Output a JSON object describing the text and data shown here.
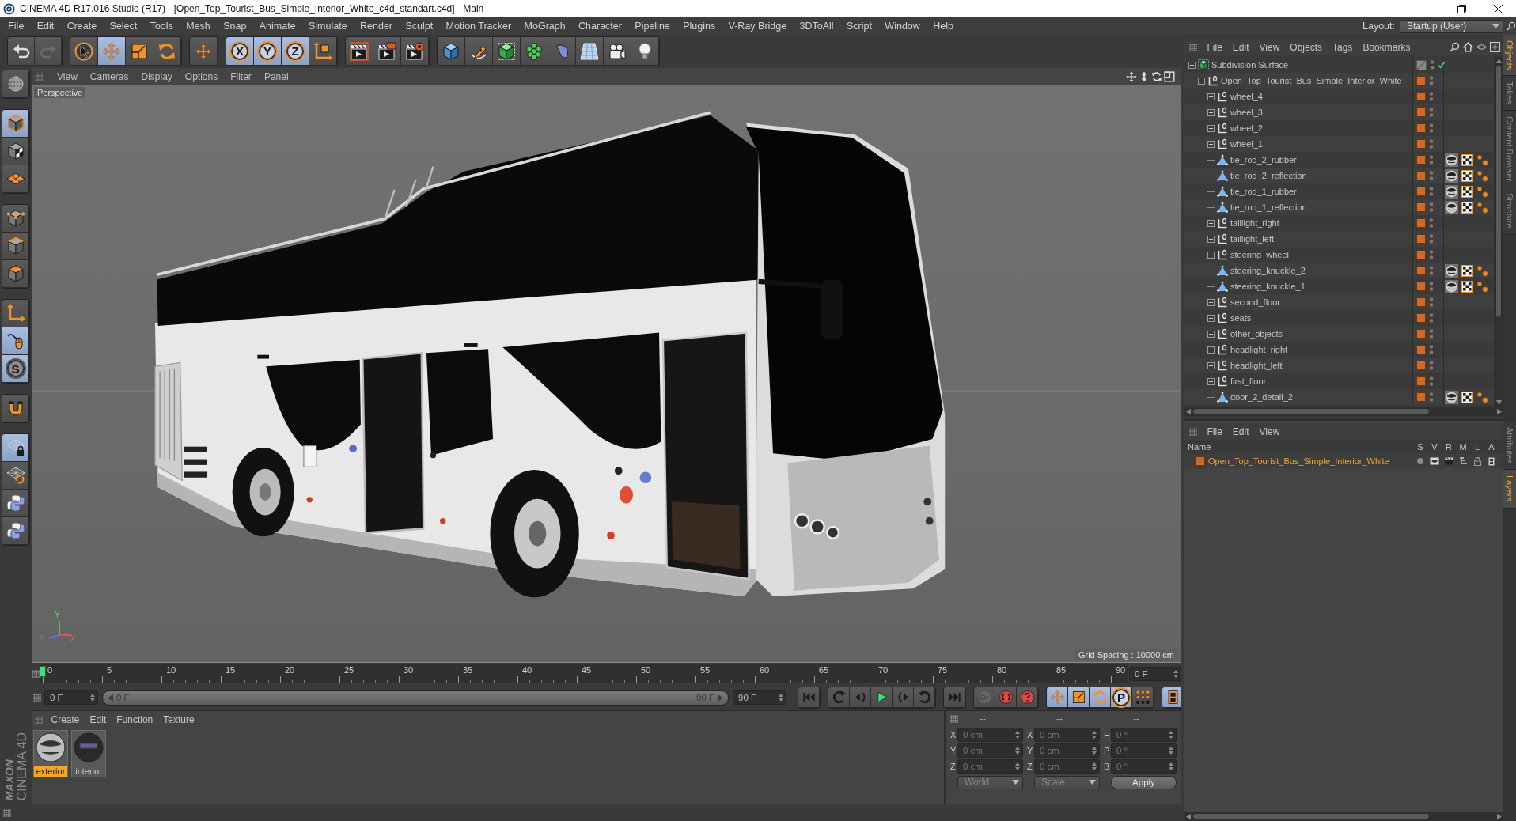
{
  "window": {
    "title": "CINEMA 4D R17.016 Studio (R17) - [Open_Top_Tourist_Bus_Simple_Interior_White_c4d_standart.c4d] - Main"
  },
  "menu_bar": {
    "items": [
      "File",
      "Edit",
      "Create",
      "Select",
      "Tools",
      "Mesh",
      "Snap",
      "Animate",
      "Simulate",
      "Render",
      "Sculpt",
      "Motion Tracker",
      "MoGraph",
      "Character",
      "Pipeline",
      "Plugins",
      "V-Ray Bridge",
      "3DToAll",
      "Script",
      "Window",
      "Help"
    ],
    "layout_label": "Layout:",
    "layout_value": "Startup (User)"
  },
  "toolbar": {
    "groups": [
      [
        {
          "kind": "undo",
          "disabled": false
        },
        {
          "kind": "redo",
          "disabled": true
        }
      ],
      [
        {
          "kind": "select",
          "active": false
        },
        {
          "kind": "move",
          "active": true
        },
        {
          "kind": "scale",
          "active": false
        },
        {
          "kind": "rotate",
          "active": false
        }
      ],
      [
        {
          "kind": "last_tool",
          "active": false
        }
      ],
      [
        {
          "kind": "axis_lock",
          "label": "X",
          "active": true
        },
        {
          "kind": "axis_lock",
          "label": "Y",
          "active": true
        },
        {
          "kind": "axis_lock",
          "label": "Z",
          "active": true
        },
        {
          "kind": "coordinate_system",
          "active": false
        }
      ],
      [
        {
          "kind": "render_view",
          "active": false
        },
        {
          "kind": "render_picture",
          "active": false
        },
        {
          "kind": "render_settings",
          "active": false
        }
      ],
      [
        {
          "kind": "cube",
          "active": false
        },
        {
          "kind": "pen",
          "active": false
        },
        {
          "kind": "subdivision",
          "active": false
        },
        {
          "kind": "cloner",
          "active": false
        },
        {
          "kind": "deformer",
          "active": false
        },
        {
          "kind": "floor",
          "active": false
        },
        {
          "kind": "camera",
          "active": false
        },
        {
          "kind": "light",
          "active": false
        }
      ]
    ]
  },
  "left_toolbar": {
    "groups": [
      [
        {
          "kind": "make_editable",
          "active": false
        }
      ],
      [
        {
          "kind": "model",
          "active": true
        },
        {
          "kind": "texture",
          "active": false
        },
        {
          "kind": "workplane",
          "active": false
        }
      ],
      [
        {
          "kind": "points",
          "active": false
        },
        {
          "kind": "edges",
          "active": false
        },
        {
          "kind": "polygons",
          "active": false
        }
      ],
      [
        {
          "kind": "axis",
          "active": false
        },
        {
          "kind": "tweak",
          "active": true
        },
        {
          "kind": "solo",
          "label": "S",
          "active": true
        }
      ],
      [
        {
          "kind": "snap",
          "active": false
        }
      ],
      [
        {
          "kind": "workplane_lock",
          "active": true
        },
        {
          "kind": "workplane_align",
          "active": false
        },
        {
          "kind": "python",
          "active": false
        },
        {
          "kind": "python",
          "active": false
        }
      ]
    ],
    "logo": [
      "MAXON",
      "CINEMA 4D"
    ]
  },
  "viewport": {
    "menu": [
      "View",
      "Cameras",
      "Display",
      "Options",
      "Filter",
      "Panel"
    ],
    "camera": "Perspective",
    "grid_spacing": "Grid Spacing : 10000 cm",
    "axes": [
      "Y",
      "Z",
      "X"
    ]
  },
  "timeline": {
    "ticks": [
      "0",
      "5",
      "10",
      "15",
      "20",
      "25",
      "30",
      "35",
      "40",
      "45",
      "50",
      "55",
      "60",
      "65",
      "70",
      "75",
      "80",
      "85",
      "90"
    ],
    "playhead": {
      "level": 0
    },
    "frame_field": "0 F"
  },
  "transport": {
    "start_field": "0 F",
    "range": {
      "start": "0 F",
      "end": "90 F",
      "level": 1
    },
    "end_field": "90 F",
    "playback": [
      [
        {
          "kind": "go_start"
        }
      ],
      [
        {
          "kind": "prev_key"
        },
        {
          "kind": "step_back"
        },
        {
          "kind": "play"
        },
        {
          "kind": "step_forward"
        },
        {
          "kind": "next_key"
        }
      ],
      [
        {
          "kind": "go_end"
        }
      ]
    ],
    "record": [
      {
        "kind": "record_keys",
        "disabled": true
      },
      {
        "kind": "autokey",
        "disabled": false
      },
      {
        "kind": "key_selection",
        "disabled": false
      }
    ],
    "key_toggles": [
      {
        "kind": "position",
        "active": true
      },
      {
        "kind": "scale",
        "active": true
      },
      {
        "kind": "rotation",
        "active": true
      },
      {
        "kind": "parameter",
        "label": "P",
        "active": true
      },
      {
        "kind": "point_level",
        "active": false
      }
    ],
    "timeline_button": {
      "active": true
    }
  },
  "material_manager": {
    "menu": [
      "Create",
      "Edit",
      "Function",
      "Texture"
    ],
    "materials": [
      {
        "name": "exterior",
        "selected": true
      },
      {
        "name": "interior",
        "selected": false
      }
    ]
  },
  "coordinates": {
    "headers": [
      "--",
      "--",
      "--"
    ],
    "rows": [
      [
        {
          "label": "X",
          "value": "0 cm"
        },
        {
          "label": "X",
          "value": "0 cm"
        },
        {
          "label": "H",
          "value": "0 °"
        }
      ],
      [
        {
          "label": "Y",
          "value": "0 cm"
        },
        {
          "label": "Y",
          "value": "0 cm"
        },
        {
          "label": "P",
          "value": "0 °"
        }
      ],
      [
        {
          "label": "Z",
          "value": "0 cm"
        },
        {
          "label": "Z",
          "value": "0 cm"
        },
        {
          "label": "B",
          "value": "0 °"
        }
      ]
    ],
    "dropdowns": [
      {
        "value": "World",
        "disabled": true
      },
      {
        "value": "Scale",
        "disabled": true
      }
    ],
    "apply": "Apply"
  },
  "object_manager": {
    "menu": [
      "File",
      "Edit",
      "View",
      "Objects",
      "Tags",
      "Bookmarks"
    ],
    "tree": [
      {
        "name": "Subdivision Surface",
        "kind": "subdivision",
        "expanded": true,
        "enabled": true,
        "selected": false,
        "children": [
          {
            "name": "Open_Top_Tourist_Bus_Simple_Interior_White",
            "kind": "null",
            "expanded": true,
            "selected": false,
            "children": [
              {
                "name": "wheel_4",
                "kind": "null",
                "expanded": false,
                "selected": false
              },
              {
                "name": "wheel_3",
                "kind": "null",
                "expanded": false,
                "selected": false
              },
              {
                "name": "wheel_2",
                "kind": "null",
                "expanded": false,
                "selected": false
              },
              {
                "name": "wheel_1",
                "kind": "null",
                "expanded": false,
                "selected": false
              },
              {
                "name": "tie_rod_2_rubber",
                "kind": "polygon",
                "selected": false,
                "tags": [
                  {
                    "kind": "material"
                  },
                  {
                    "kind": "uvw"
                  },
                  {
                    "kind": "phong"
                  }
                ]
              },
              {
                "name": "tie_rod_2_reflection",
                "kind": "polygon",
                "selected": false,
                "tags": [
                  {
                    "kind": "material"
                  },
                  {
                    "kind": "uvw"
                  },
                  {
                    "kind": "phong"
                  }
                ]
              },
              {
                "name": "tie_rod_1_rubber",
                "kind": "polygon",
                "selected": false,
                "tags": [
                  {
                    "kind": "material"
                  },
                  {
                    "kind": "uvw"
                  },
                  {
                    "kind": "phong"
                  }
                ]
              },
              {
                "name": "tie_rod_1_reflection",
                "kind": "polygon",
                "selected": false,
                "tags": [
                  {
                    "kind": "material"
                  },
                  {
                    "kind": "uvw"
                  },
                  {
                    "kind": "phong"
                  }
                ]
              },
              {
                "name": "taillight_right",
                "kind": "null",
                "expanded": false,
                "selected": false
              },
              {
                "name": "taillight_left",
                "kind": "null",
                "expanded": false,
                "selected": false
              },
              {
                "name": "steering_wheel",
                "kind": "null",
                "expanded": false,
                "selected": false
              },
              {
                "name": "steering_knuckle_2",
                "kind": "polygon",
                "selected": false,
                "tags": [
                  {
                    "kind": "material"
                  },
                  {
                    "kind": "uvw"
                  },
                  {
                    "kind": "phong"
                  }
                ]
              },
              {
                "name": "steering_knuckle_1",
                "kind": "polygon",
                "selected": false,
                "tags": [
                  {
                    "kind": "material"
                  },
                  {
                    "kind": "uvw"
                  },
                  {
                    "kind": "phong"
                  }
                ]
              },
              {
                "name": "second_floor",
                "kind": "null",
                "expanded": false,
                "selected": false
              },
              {
                "name": "seats",
                "kind": "null",
                "expanded": false,
                "selected": false
              },
              {
                "name": "other_objects",
                "kind": "null",
                "expanded": false,
                "selected": false
              },
              {
                "name": "headlight_right",
                "kind": "null",
                "expanded": false,
                "selected": false
              },
              {
                "name": "headlight_left",
                "kind": "null",
                "expanded": false,
                "selected": false
              },
              {
                "name": "first_floor",
                "kind": "null",
                "expanded": false,
                "selected": false
              },
              {
                "name": "door_2_detail_2",
                "kind": "polygon",
                "selected": false,
                "tags": [
                  {
                    "kind": "material"
                  },
                  {
                    "kind": "uvw"
                  },
                  {
                    "kind": "phong"
                  }
                ]
              }
            ]
          }
        ]
      }
    ]
  },
  "layer_manager": {
    "menu": [
      "File",
      "Edit",
      "View"
    ],
    "columns": [
      "Name",
      "S",
      "V",
      "R",
      "M",
      "L",
      "A"
    ],
    "layers": [
      {
        "name": "Open_Top_Tourist_Bus_Simple_Interior_White",
        "color": "#cc6a2a",
        "selected": true
      }
    ]
  },
  "side_tabs": {
    "upper": [
      {
        "label": "Objects",
        "selected": true
      },
      {
        "label": "Takes",
        "selected": false
      },
      {
        "label": "Content Browser",
        "selected": false
      },
      {
        "label": "Structure",
        "selected": false
      }
    ],
    "lower": [
      {
        "label": "Attributes",
        "selected": false
      },
      {
        "label": "Layers",
        "selected": true
      }
    ]
  }
}
